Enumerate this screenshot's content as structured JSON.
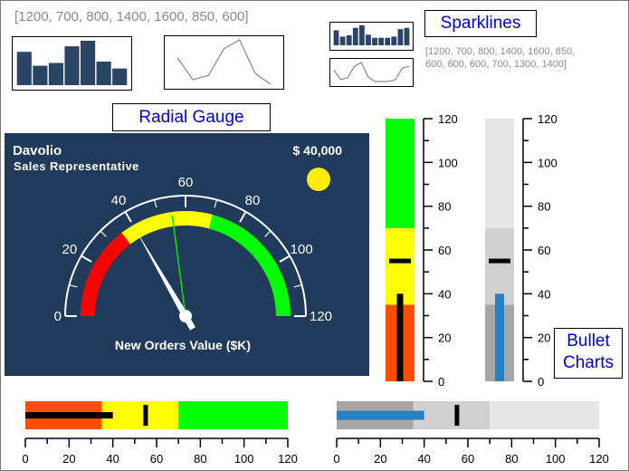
{
  "titles": {
    "sparklines": "Sparklines",
    "radial_gauge": "Radial Gauge",
    "bullet_charts_line1": "Bullet",
    "bullet_charts_line2": "Charts"
  },
  "sparkline_data_text_1": "[1200, 700, 800, 1400, 1600, 850, 600]",
  "sparkline_data_text_2a": "[1200, 700, 800, 1400, 1600, 850,",
  "sparkline_data_text_2b": "600, 600, 600, 700, 1300, 1400]",
  "gauge_panel": {
    "name": "Davolio",
    "role": "Sales Representative",
    "amount": "$ 40,000",
    "label": "New Orders Value ($K)"
  },
  "colors": {
    "panel_bg": "#1f3a5a",
    "spark_bar": "#2a4566",
    "red": "#ff0000",
    "orange": "#ff4e00",
    "yellow": "#ffff00",
    "green": "#00ff00",
    "sun": "#ffee00",
    "gray_dark": "#a6a6a6",
    "gray_mid": "#d0d0d0",
    "gray_light": "#e6e6e6",
    "blue": "#2a7fc0",
    "title_blue": "#0000cc"
  },
  "chart_data": [
    {
      "type": "bar",
      "id": "sparkline-bar-large",
      "categories": [
        "1",
        "2",
        "3",
        "4",
        "5",
        "6",
        "7"
      ],
      "values": [
        1200,
        700,
        800,
        1400,
        1600,
        850,
        600
      ],
      "ylim": [
        0,
        1600
      ]
    },
    {
      "type": "line",
      "id": "sparkline-line-large",
      "categories": [
        "1",
        "2",
        "3",
        "4",
        "5",
        "6",
        "7"
      ],
      "values": [
        1200,
        700,
        800,
        1400,
        1600,
        850,
        600
      ],
      "ylim": [
        0,
        1600
      ]
    },
    {
      "type": "bar",
      "id": "sparkline-bar-small",
      "categories": [
        "1",
        "2",
        "3",
        "4",
        "5",
        "6",
        "7",
        "8",
        "9",
        "10",
        "11",
        "12"
      ],
      "values": [
        1200,
        700,
        800,
        1400,
        1600,
        850,
        600,
        600,
        600,
        700,
        1300,
        1400
      ],
      "ylim": [
        0,
        1600
      ]
    },
    {
      "type": "line",
      "id": "sparkline-line-small",
      "categories": [
        "1",
        "2",
        "3",
        "4",
        "5",
        "6",
        "7",
        "8",
        "9",
        "10",
        "11",
        "12"
      ],
      "values": [
        1200,
        700,
        800,
        1400,
        1600,
        850,
        600,
        600,
        600,
        700,
        1300,
        1400
      ],
      "ylim": [
        0,
        1600
      ]
    },
    {
      "type": "gauge",
      "id": "radial-gauge",
      "range": [
        0,
        120
      ],
      "ticks": [
        "0",
        "20",
        "40",
        "60",
        "80",
        "100",
        "120"
      ],
      "bands": [
        {
          "from": 0,
          "to": 35,
          "color": "#ff0000"
        },
        {
          "from": 35,
          "to": 70,
          "color": "#ffff00"
        },
        {
          "from": 70,
          "to": 120,
          "color": "#00ff00"
        }
      ],
      "needle_value": 40,
      "target_value": 55
    },
    {
      "type": "bullet",
      "id": "bullet-vertical-color",
      "orientation": "vertical",
      "range": [
        0,
        120
      ],
      "ticks": [
        "0",
        "20",
        "40",
        "60",
        "80",
        "100",
        "120"
      ],
      "bands": [
        {
          "from": 0,
          "to": 35,
          "color": "#ff4e00"
        },
        {
          "from": 35,
          "to": 70,
          "color": "#ffff00"
        },
        {
          "from": 70,
          "to": 120,
          "color": "#00ff00"
        }
      ],
      "value": 40,
      "target": 55,
      "bar_color": "#000000"
    },
    {
      "type": "bullet",
      "id": "bullet-vertical-gray",
      "orientation": "vertical",
      "range": [
        0,
        120
      ],
      "ticks": [
        "0",
        "20",
        "40",
        "60",
        "80",
        "100",
        "120"
      ],
      "bands": [
        {
          "from": 0,
          "to": 35,
          "color": "#a6a6a6"
        },
        {
          "from": 35,
          "to": 70,
          "color": "#d0d0d0"
        },
        {
          "from": 70,
          "to": 120,
          "color": "#e6e6e6"
        }
      ],
      "value": 40,
      "target": 55,
      "bar_color": "#2a7fc0"
    },
    {
      "type": "bullet",
      "id": "bullet-horizontal-color",
      "orientation": "horizontal",
      "range": [
        0,
        120
      ],
      "ticks": [
        "0",
        "20",
        "40",
        "60",
        "80",
        "100",
        "120"
      ],
      "bands": [
        {
          "from": 0,
          "to": 35,
          "color": "#ff4e00"
        },
        {
          "from": 35,
          "to": 70,
          "color": "#ffff00"
        },
        {
          "from": 70,
          "to": 120,
          "color": "#00ff00"
        }
      ],
      "value": 40,
      "target": 55,
      "bar_color": "#000000"
    },
    {
      "type": "bullet",
      "id": "bullet-horizontal-gray",
      "orientation": "horizontal",
      "range": [
        0,
        120
      ],
      "ticks": [
        "0",
        "20",
        "40",
        "60",
        "80",
        "100",
        "120"
      ],
      "bands": [
        {
          "from": 0,
          "to": 35,
          "color": "#a6a6a6"
        },
        {
          "from": 35,
          "to": 70,
          "color": "#d0d0d0"
        },
        {
          "from": 70,
          "to": 120,
          "color": "#e6e6e6"
        }
      ],
      "value": 40,
      "target": 55,
      "bar_color": "#2a7fc0"
    }
  ]
}
